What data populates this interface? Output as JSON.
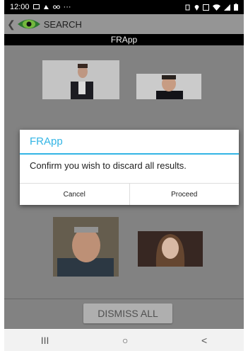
{
  "status_bar": {
    "time": "12:00",
    "left_icons": [
      "message-icon",
      "sim-icon",
      "voicemail-icon"
    ],
    "overflow": "···",
    "right_icons": [
      "vibrate-icon",
      "location-icon",
      "volte-icon",
      "wifi-icon",
      "signal-icon",
      "battery-icon"
    ]
  },
  "action_bar": {
    "title": "SEARCH"
  },
  "app_title": "FRApp",
  "dialog": {
    "title": "FRApp",
    "message": "Confirm you wish to discard all results.",
    "cancel_label": "Cancel",
    "proceed_label": "Proceed"
  },
  "bottom": {
    "dismiss_label": "DISMISS ALL"
  },
  "nav_bar": {
    "recents": "III",
    "home": "○",
    "back": "<"
  },
  "colors": {
    "accent": "#33b5e5",
    "content_bg": "#8a8a8a",
    "actionbar_bg": "#9d9d9d"
  }
}
